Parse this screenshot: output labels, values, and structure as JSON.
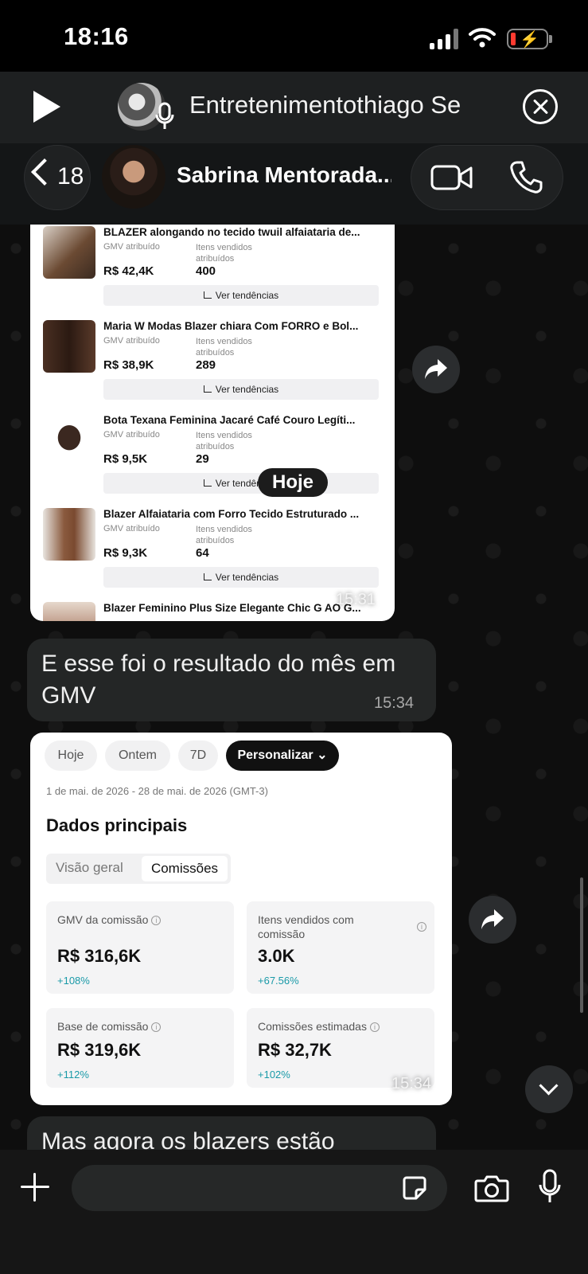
{
  "status_bar": {
    "time": "18:16"
  },
  "audio_player": {
    "title": "Entretenimentothiago Se"
  },
  "chat_header": {
    "back_count": "18",
    "contact_name": "Sabrina Mentorada..."
  },
  "product_list": {
    "date_chip": "Hoje",
    "timestamp": "15:31",
    "trend_label": "Ver tendências",
    "gmv_label": "GMV atribuído",
    "sold_label": "Itens vendidos atribuídos",
    "products": [
      {
        "title": "BLAZER alongando no tecido twuil alfaiataria de...",
        "gmv": "R$ 42,4K",
        "sold": "400"
      },
      {
        "title": "Maria W Modas Blazer chiara Com FORRO e Bol...",
        "gmv": "R$ 38,9K",
        "sold": "289"
      },
      {
        "title": "Bota Texana Feminina Jacaré Café Couro Legíti...",
        "gmv": "R$ 9,5K",
        "sold": "29"
      },
      {
        "title": "Blazer Alfaiataria com Forro Tecido Estruturado ...",
        "gmv": "R$ 9,3K",
        "sold": "64"
      },
      {
        "title": "Blazer Feminino Plus Size Elegante Chic G AO G..."
      }
    ]
  },
  "messages": [
    {
      "text": "E esse foi o resultado do mês em GMV",
      "time": "15:34"
    },
    {
      "text": "Mas agora os blazers estão"
    }
  ],
  "dashboard": {
    "timestamp": "15:34",
    "chips": [
      "Hoje",
      "Ontem",
      "7D",
      "Personalizar"
    ],
    "active_chip": "Personalizar",
    "range": "1 de mai. de 2026 - 28 de mai. de 2026 (GMT-3)",
    "title": "Dados principais",
    "tabs": [
      "Visão geral",
      "Comissões"
    ],
    "metrics": [
      {
        "label": "GMV da comissão",
        "value": "R$ 316,6K",
        "delta": "+108%"
      },
      {
        "label": "Itens vendidos com comissão",
        "value": "3.0K",
        "delta": "+67.56%"
      },
      {
        "label": "Base de comissão",
        "value": "R$ 319,6K",
        "delta": "+112%"
      },
      {
        "label": "Comissões estimadas",
        "value": "R$ 32,7K",
        "delta": "+102%"
      }
    ]
  },
  "input": {
    "placeholder": ""
  },
  "colors": {
    "delta": "#1a9aa8",
    "bubble": "#242626",
    "background": "#0e0e0e"
  },
  "icons": [
    "play-icon",
    "close-icon",
    "chevron-left-icon",
    "video-icon",
    "phone-icon",
    "forward-icon",
    "chevron-down-icon",
    "plus-icon",
    "sticker-icon",
    "camera-icon",
    "mic-icon"
  ]
}
